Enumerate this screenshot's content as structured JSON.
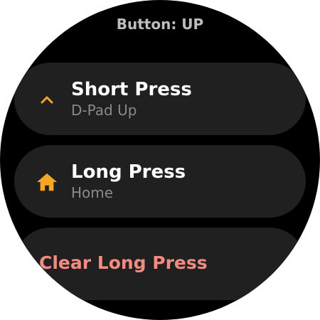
{
  "screen": {
    "title": "Button: UP"
  },
  "chips": {
    "short_press": {
      "label": "Short Press",
      "secondary": "D-Pad Up",
      "icon": "chevron-up-icon"
    },
    "long_press": {
      "label": "Long Press",
      "secondary": "Home",
      "icon": "home-icon"
    },
    "clear": {
      "label": "Clear Long Press"
    }
  },
  "colors": {
    "background": "#000000",
    "chip": "#202020",
    "accent_icon": "#f5a623",
    "clear_text": "#f28b82",
    "primary_text": "#ffffff",
    "secondary_text": "#8a8a8a",
    "title_text": "#bdbdbd"
  }
}
